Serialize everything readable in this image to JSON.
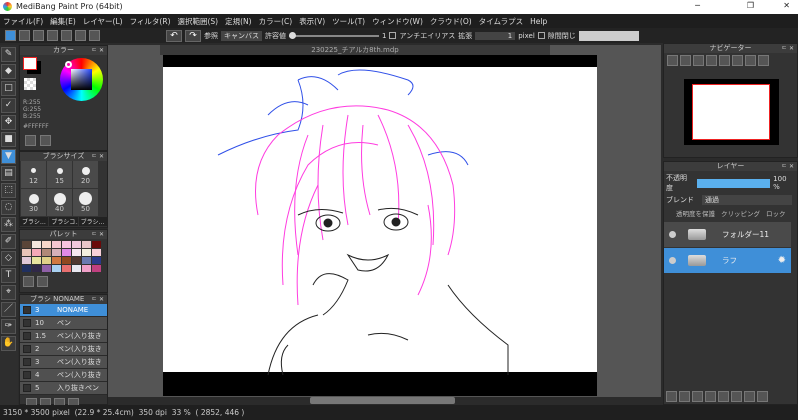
{
  "window": {
    "title": "MediBang Paint Pro (64bit)",
    "min": "─",
    "restore": "❐",
    "close": "✕"
  },
  "menu": [
    "ファイル(F)",
    "編集(E)",
    "レイヤー(L)",
    "フィルタ(R)",
    "選択範囲(S)",
    "定規(N)",
    "カラー(C)",
    "表示(V)",
    "ツール(T)",
    "ウィンドウ(W)",
    "クラウド(O)",
    "タイムラプス",
    "Help"
  ],
  "toolbar": {
    "undo": "↶",
    "redo": "↷",
    "ref_label": "参照",
    "ref_value": "キャンバス",
    "tol_label": "許容値",
    "tol_value": "1",
    "antialias": "アンチエイリアス",
    "expand_label": "拡張",
    "expand_value": "1",
    "unit": "pixel",
    "gap_close": "隙間閉じ"
  },
  "canvas": {
    "tab": "230225_チアルカ8th.mdp"
  },
  "color_panel": {
    "title": "カラー",
    "r": "R:255",
    "g": "G:255",
    "b": "B:255",
    "hex": "#FFFFFF",
    "fg": "#FFFFFF"
  },
  "brush_size": {
    "title": "ブラシサイズ",
    "sizes": [
      "12",
      "15",
      "20",
      "30",
      "40",
      "50"
    ],
    "tabs": [
      "ブラシ…",
      "ブラシコ…",
      "ブラシ…"
    ]
  },
  "palette": {
    "title": "パレット",
    "colors": [
      "#5a4538",
      "#f3e6dc",
      "#f6d6c8",
      "#f4c7d1",
      "#f6c4e0",
      "#f0c8dc",
      "#e8c6c9",
      "#6a0a0a",
      "#e8c4b8",
      "#f5a8b8",
      "#b08878",
      "#d6b0b8",
      "#e08ae8",
      "#f6e8f0",
      "#f3f0e0",
      "#f8d0d8",
      "#e0c8d8",
      "#e8e4a0",
      "#e0d088",
      "#d07840",
      "#904820",
      "#503830",
      "#6a7ab0",
      "#2a3a8a",
      "#203060",
      "#302848",
      "#9060a8",
      "#a8d0f0",
      "#e87070",
      "#e8e8f0",
      "#f0a0c8",
      "#c04080"
    ]
  },
  "brush_list": {
    "title": "ブラシ",
    "current": "NONAME",
    "items": [
      {
        "size": "3",
        "name": "NONAME"
      },
      {
        "size": "10",
        "name": "ペン"
      },
      {
        "size": "1.5",
        "name": "ペン(入り抜き"
      },
      {
        "size": "2",
        "name": "ペン(入り抜き"
      },
      {
        "size": "3",
        "name": "ペン(入り抜き"
      },
      {
        "size": "4",
        "name": "ペン(入り抜き"
      },
      {
        "size": "5",
        "name": "入り抜きペン"
      }
    ]
  },
  "navigator": {
    "title": "ナビゲーター"
  },
  "layer_panel": {
    "title": "レイヤー",
    "opacity_label": "不透明度",
    "opacity": 100,
    "opacity_text": "100 %",
    "blend_label": "ブレンド",
    "blend_value": "通過",
    "protect": "透明度を保護",
    "clipping": "クリッピング",
    "lock": "ロック",
    "layers": [
      {
        "name": "フォルダー11",
        "selected": false
      },
      {
        "name": "ラフ",
        "selected": true
      }
    ]
  },
  "status": {
    "size": "3150 * 3500 pixel",
    "cm": "(22.9 * 25.4cm)",
    "dpi": "350 dpi",
    "zoom": "33 %",
    "coords": "( 2852, 446 )"
  },
  "colors": {
    "accent": "#3f8fd8",
    "line_pink": "#ff3ce0",
    "line_blue": "#3050e8"
  }
}
